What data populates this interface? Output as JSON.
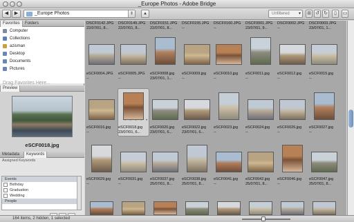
{
  "window": {
    "title": "_Europe Photos - Adobe Bridge"
  },
  "toolbar": {
    "path": "_Europe Photos",
    "filter": "Unfiltered"
  },
  "left_panel": {
    "tabs": [
      {
        "label": "Favorites"
      },
      {
        "label": "Folders"
      }
    ],
    "favorites": [
      {
        "label": "Computer",
        "icon": "computer-icon",
        "color": "#7d8aa0"
      },
      {
        "label": "Collections",
        "icon": "collections-icon",
        "color": "#5b7fb8"
      },
      {
        "label": "azisman",
        "icon": "home-icon",
        "color": "#c8a040"
      },
      {
        "label": "Desktop",
        "icon": "desktop-icon",
        "color": "#6a86b6"
      },
      {
        "label": "Documents",
        "icon": "documents-icon",
        "color": "#6a86b6"
      },
      {
        "label": "Pictures",
        "icon": "pictures-icon",
        "color": "#6a86b6"
      }
    ],
    "drag_hint": "Drag Favorites Here...",
    "preview_tab": "Preview",
    "preview_caption": "eSCF0018.jpg",
    "metadata_tabs": [
      {
        "label": "Metadata"
      },
      {
        "label": "Keywords"
      }
    ],
    "assigned_keywords": "Assigned Keywords",
    "keywords": [
      {
        "label": "Events",
        "category": true
      },
      {
        "label": "Birthday",
        "category": false
      },
      {
        "label": "Graduation",
        "category": false
      },
      {
        "label": "Wedding",
        "category": false
      },
      {
        "label": "People",
        "category": true
      }
    ]
  },
  "grid": {
    "rows": [
      {
        "top_labels": [
          [
            "DSCF0142.JPG",
            "22/07/01, 8..."
          ],
          [
            "DSCF0149.JPG",
            "22/07/01, 8..."
          ],
          [
            "DSCF0151.JPG",
            "22/07/01, 8..."
          ],
          [
            "DSCF0155.JPG",
            "--"
          ],
          [
            "DSCF0160.JPG",
            "--"
          ],
          [
            "DSCF0001.JPG",
            "23/07/01, 9..."
          ],
          [
            "DSCF0002.JPG",
            "--"
          ],
          [
            "DSCF0003.JPG",
            "23/07/01, 1..."
          ]
        ]
      },
      {
        "labels": [
          [
            "eSCF0004.JPG",
            "--"
          ],
          [
            "eSCF0005.JPG",
            "--"
          ],
          [
            "eSCF0008.jpg",
            "23/07/01, 1..."
          ],
          [
            "eSCF0009.jpg",
            "--"
          ],
          [
            "eSCF0010.jpg",
            "--"
          ],
          [
            "eSCF0011.jpg",
            "--"
          ],
          [
            "eSCF0012.jpg",
            "--"
          ],
          [
            "eSCF0015.jpg",
            "--"
          ]
        ]
      },
      {
        "labels": [
          [
            "eSCF0016.jpg",
            "--"
          ],
          [
            "eSCF0018.jpg",
            "23/07/01, 6..."
          ],
          [
            "eSCF0020.jpg",
            "23/07/01, 6..."
          ],
          [
            "eSCF0022.jpg",
            "23/07/01, 6..."
          ],
          [
            "eSCF0023.jpg",
            "--"
          ],
          [
            "eSCF0024.jpg",
            "--"
          ],
          [
            "eSCF0026.jpg",
            "--"
          ],
          [
            "eSCF0027.jpg",
            "--"
          ]
        ]
      },
      {
        "labels": [
          [
            "eSCF0029.jpg",
            "--"
          ],
          [
            "eSCF0031.jpg",
            "--"
          ],
          [
            "eSCF0037.jpg",
            "25/07/01, 8..."
          ],
          [
            "eSCF0038.jpg",
            "25/07/01, 8..."
          ],
          [
            "eSCF0041.jpg",
            "--"
          ],
          [
            "eSCF0042.jpg",
            "25/07/01, 8..."
          ],
          [
            "eSCF0046.jpg",
            "--"
          ],
          [
            "eSCF0047.jpg",
            "25/07/01, 8..."
          ]
        ]
      }
    ],
    "selected_dots": "• • • • •"
  },
  "status": {
    "text": "164 items, 2 hidden, 1 selected"
  }
}
